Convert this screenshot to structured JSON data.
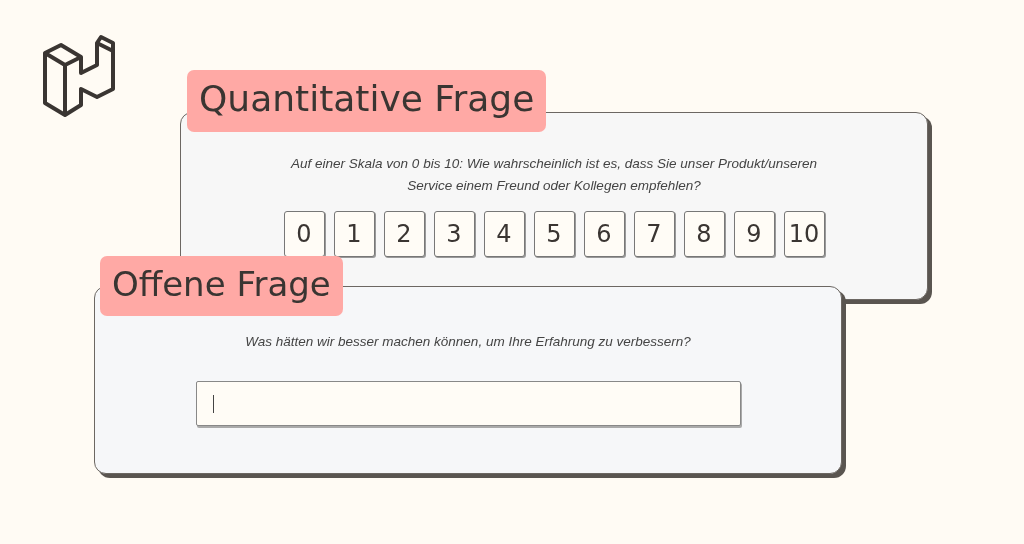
{
  "cards": [
    {
      "kind": "scale",
      "label": "Quantitative Frage",
      "question": "Auf einer Skala von 0 bis 10: Wie wahrscheinlich ist es, dass Sie unser Produkt/unseren Service einem Freund oder Kollegen empfehlen?",
      "options": [
        "0",
        "1",
        "2",
        "3",
        "4",
        "5",
        "6",
        "7",
        "8",
        "9",
        "10"
      ]
    },
    {
      "kind": "text",
      "label": "Offene Frage",
      "question": "Was hätten wir besser machen können, um Ihre Erfahrung zu verbessern?"
    }
  ]
}
